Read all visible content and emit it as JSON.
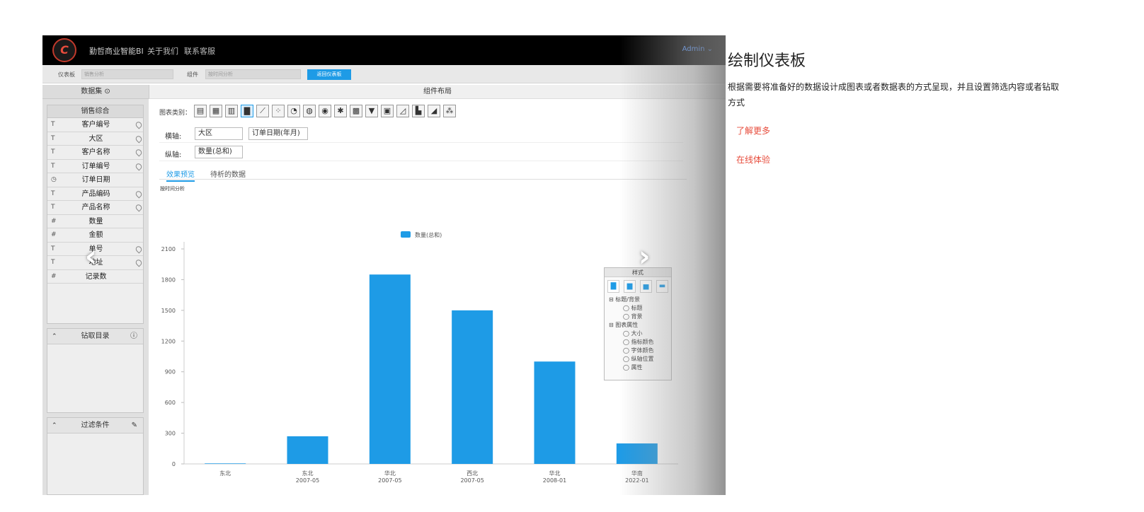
{
  "topbar": {
    "logo": "C",
    "brand": "勤哲商业智能BI",
    "nav": [
      "关于我们",
      "联系客服"
    ],
    "admin": "Admin ⌄"
  },
  "subbar": {
    "dashboard_label": "仪表板",
    "dashboard_value": "销售分析",
    "component_label": "组件",
    "component_value": "按时间分析",
    "back_button": "返回仪表板"
  },
  "sidebar": {
    "title": "数据集 ⊙",
    "dataset": "销售综合",
    "fields": [
      {
        "type": "T",
        "name": "客户编号",
        "pin": true
      },
      {
        "type": "T",
        "name": "大区",
        "pin": true
      },
      {
        "type": "T",
        "name": "客户名称",
        "pin": true
      },
      {
        "type": "T",
        "name": "订单编号",
        "pin": true
      },
      {
        "type": "◷",
        "name": "订单日期",
        "pin": false
      },
      {
        "type": "T",
        "name": "产品编码",
        "pin": true
      },
      {
        "type": "T",
        "name": "产品名称",
        "pin": true
      },
      {
        "type": "#",
        "name": "数量",
        "pin": false
      },
      {
        "type": "#",
        "name": "金额",
        "pin": false
      },
      {
        "type": "T",
        "name": "单号",
        "pin": true
      },
      {
        "type": "T",
        "name": "地址",
        "pin": true
      },
      {
        "type": "#",
        "name": "记录数",
        "pin": false
      }
    ],
    "drill_title": "钻取目录",
    "filter_title": "过滤条件"
  },
  "main": {
    "header": "组件布局",
    "chart_type_label": "图表类别：",
    "x_label": "横轴:",
    "x_values": [
      "大区",
      "订单日期(年月)"
    ],
    "y_label": "纵轴:",
    "y_value": "数量(总和)",
    "tabs": [
      "效果预览",
      "待析的数据"
    ],
    "chart_title": "按时间分析"
  },
  "style_panel": {
    "title": "样式",
    "tree": [
      {
        "label": "⊟ 标题/背景",
        "child": false
      },
      {
        "label": "◯ 标题",
        "child": true
      },
      {
        "label": "◯ 背景",
        "child": true
      },
      {
        "label": "⊟ 图表属性",
        "child": false
      },
      {
        "label": "◯ 大小",
        "child": true
      },
      {
        "label": "◯ 指标颜色",
        "child": true
      },
      {
        "label": "◯ 字体颜色",
        "child": true
      },
      {
        "label": "◯ 纵轴位置",
        "child": true
      },
      {
        "label": "◯ 属性",
        "child": true
      }
    ]
  },
  "chart_data": {
    "type": "bar",
    "categories": [
      [
        "东北",
        ""
      ],
      [
        "东北",
        "2007-05"
      ],
      [
        "华北",
        "2007-05"
      ],
      [
        "西北",
        "2007-05"
      ],
      [
        "华北",
        "2008-01"
      ],
      [
        "华南",
        "2022-01"
      ]
    ],
    "series": [
      {
        "name": "数量(总和)",
        "values": [
          5,
          270,
          1850,
          1500,
          1000,
          200
        ],
        "color": "#1e9be6"
      }
    ],
    "yticks": [
      0,
      300,
      600,
      900,
      1200,
      1500,
      1800,
      2100
    ],
    "ylim": [
      0,
      2100
    ],
    "legend": "top-center"
  },
  "right": {
    "title": "绘制仪表板",
    "desc": "根据需要将准备好的数据设计成图表或者数据表的方式呈现，并且设置筛选内容或者钻取方式",
    "link1": "了解更多",
    "link2": "在线体验"
  }
}
